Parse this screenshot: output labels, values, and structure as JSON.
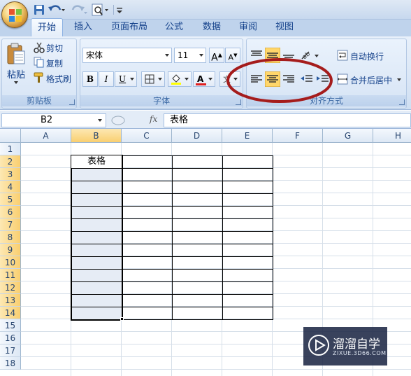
{
  "quick_access": {
    "icons": [
      "save-icon",
      "undo-icon",
      "redo-icon",
      "print-preview-icon",
      "customize-icon"
    ]
  },
  "tabs": [
    {
      "label": "开始",
      "active": true
    },
    {
      "label": "插入"
    },
    {
      "label": "页面布局"
    },
    {
      "label": "公式"
    },
    {
      "label": "数据"
    },
    {
      "label": "审阅"
    },
    {
      "label": "视图"
    }
  ],
  "clipboard": {
    "paste": "粘贴",
    "cut": "剪切",
    "copy": "复制",
    "format_painter": "格式刷",
    "group_label": "剪贴板"
  },
  "font": {
    "name": "宋体",
    "size": "11",
    "bold": "B",
    "italic": "I",
    "underline": "U",
    "font_color_letter": "A",
    "fill_color": "#ffff00",
    "font_color": "#e02020",
    "group_label": "字体"
  },
  "alignment": {
    "wrap_text": "自动换行",
    "merge_center": "合并后居中",
    "group_label": "对齐方式",
    "highlight_color": "#a51c1c"
  },
  "formula_bar": {
    "name_box": "B2",
    "fx": "fx",
    "content": "表格"
  },
  "sheet": {
    "columns": [
      "A",
      "B",
      "C",
      "D",
      "E",
      "F",
      "G",
      "H"
    ],
    "rows": [
      "1",
      "2",
      "3",
      "4",
      "5",
      "6",
      "7",
      "8",
      "9",
      "10",
      "11",
      "12",
      "13",
      "14",
      "15",
      "16",
      "17",
      "18"
    ],
    "selected_column": "B",
    "cells": {
      "B2": "表格"
    }
  },
  "watermark": {
    "title": "溜溜自学",
    "url": "ZIXUE.3D66.COM"
  }
}
